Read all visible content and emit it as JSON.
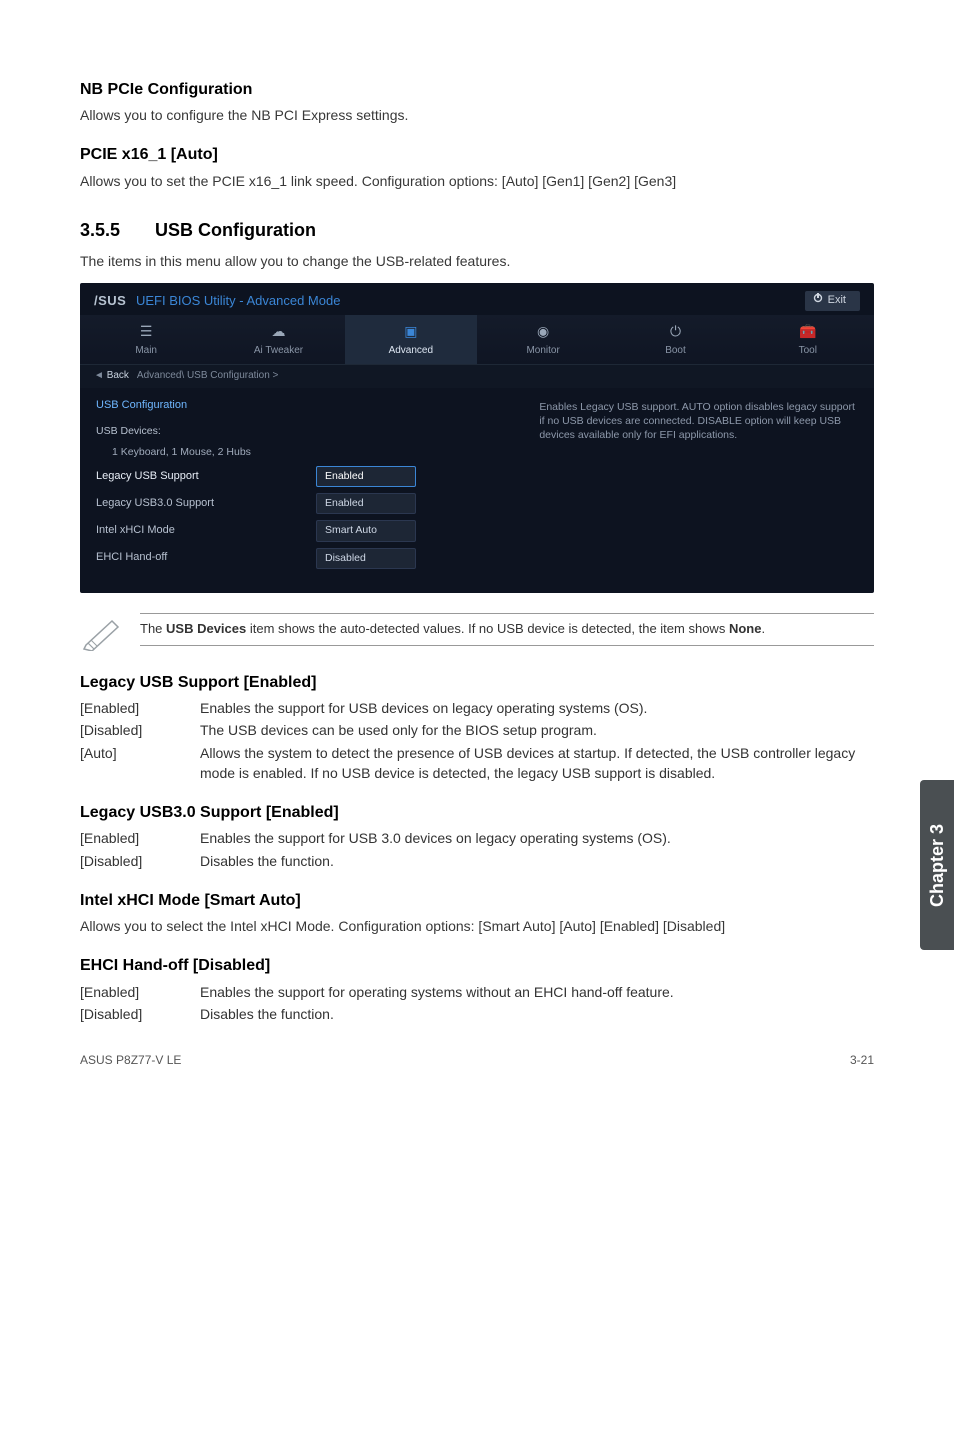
{
  "sections": {
    "nb_pcie": {
      "title": "NB PCIe Configuration",
      "desc": "Allows you to configure the NB PCI Express settings."
    },
    "pcie_x16": {
      "title": "PCIE x16_1 [Auto]",
      "desc": "Allows you to set the PCIE x16_1 link speed. Configuration options: [Auto] [Gen1] [Gen2] [Gen3]"
    },
    "usb_conf": {
      "num": "3.5.5",
      "title": "USB Configuration",
      "desc": "The items in this menu allow you to change the USB-related features."
    },
    "legacy_usb": {
      "title": "Legacy USB Support [Enabled]",
      "opts": [
        {
          "k": "[Enabled]",
          "v": "Enables the support for USB devices on legacy operating systems (OS)."
        },
        {
          "k": "[Disabled]",
          "v": "The USB devices can be used only for the BIOS setup program."
        },
        {
          "k": "[Auto]",
          "v": "Allows the system to detect the presence of USB devices at startup. If detected, the USB controller legacy mode is enabled. If no USB device is detected, the legacy USB support is disabled."
        }
      ]
    },
    "legacy_usb3": {
      "title": "Legacy USB3.0 Support [Enabled]",
      "opts": [
        {
          "k": "[Enabled]",
          "v": "Enables the support for USB 3.0 devices on legacy operating systems (OS)."
        },
        {
          "k": "[Disabled]",
          "v": "Disables the function."
        }
      ]
    },
    "xhci": {
      "title": "Intel xHCI Mode [Smart Auto]",
      "desc": "Allows you to select the Intel xHCI Mode. Configuration options: [Smart Auto] [Auto] [Enabled] [Disabled]"
    },
    "ehci": {
      "title": "EHCI Hand-off [Disabled]",
      "opts": [
        {
          "k": "[Enabled]",
          "v": "Enables the support for operating systems without an EHCI hand-off feature."
        },
        {
          "k": "[Disabled]",
          "v": "Disables the function."
        }
      ]
    }
  },
  "bios": {
    "logo": "/SUS",
    "title": "UEFI BIOS Utility - Advanced Mode",
    "exit": "Exit",
    "tabs": [
      "Main",
      "Ai Tweaker",
      "Advanced",
      "Monitor",
      "Boot",
      "Tool"
    ],
    "selected_tab": "Advanced",
    "back": "Back",
    "crumb": "Advanced\\ USB Configuration >",
    "group": "USB Configuration",
    "devices_label": "USB Devices:",
    "devices_value": "1 Keyboard, 1 Mouse, 2 Hubs",
    "rows": [
      {
        "label": "Legacy USB Support",
        "value": "Enabled",
        "selected": true
      },
      {
        "label": "Legacy USB3.0 Support",
        "value": "Enabled",
        "selected": false
      },
      {
        "label": "Intel xHCI Mode",
        "value": "Smart Auto",
        "selected": false
      },
      {
        "label": "EHCI Hand-off",
        "value": "Disabled",
        "selected": false
      }
    ],
    "help": "Enables Legacy USB support. AUTO option disables legacy support if no USB devices are connected. DISABLE option will keep USB devices available only for EFI applications."
  },
  "note": {
    "pre": "The ",
    "bold1": "USB Devices",
    "mid": " item shows the auto-detected values. If no USB device is detected, the item shows ",
    "bold2": "None",
    "post": "."
  },
  "sidetab": "Chapter 3",
  "footer": {
    "left": "ASUS P8Z77-V LE",
    "right": "3-21"
  }
}
